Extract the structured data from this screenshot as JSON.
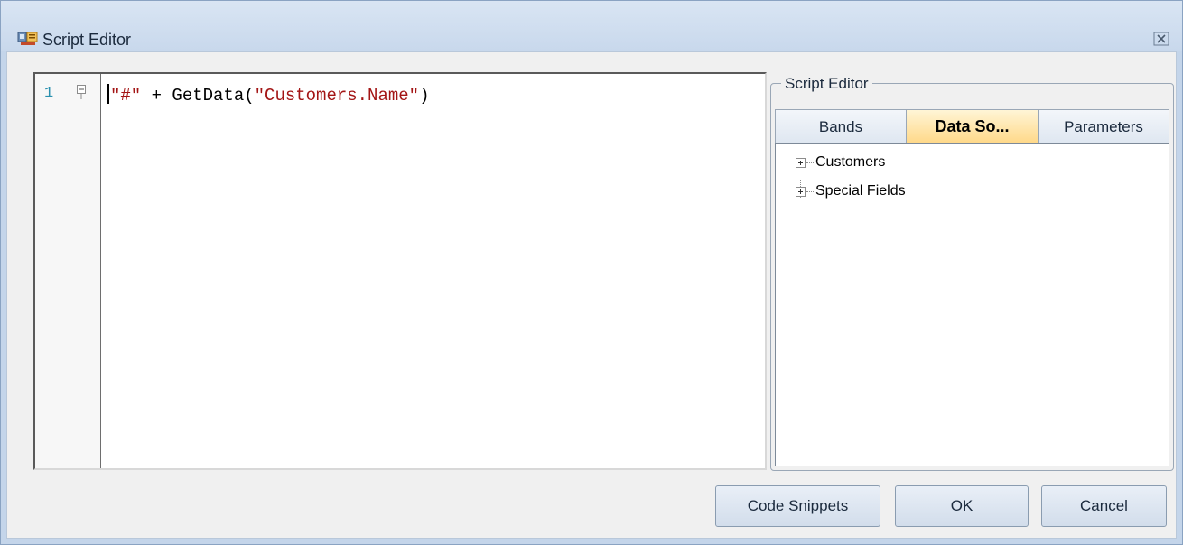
{
  "window": {
    "title": "Script Editor",
    "title_icon": "script-editor-app-icon",
    "close_icon": "close-icon"
  },
  "editor": {
    "line_number": "1",
    "fold_icon": "fold-collapse-icon",
    "code_tokens": {
      "str1": "\"#\"",
      "op": " + GetData(",
      "str2": "\"Customers.Name\"",
      "close": ")"
    },
    "string_color": "#a31515",
    "line_number_color": "#2b91af"
  },
  "side_panel": {
    "group_label": "Script Editor",
    "tabs": [
      {
        "label": "Bands",
        "active": false
      },
      {
        "label": "Data So...",
        "active": true
      },
      {
        "label": "Parameters",
        "active": false
      }
    ],
    "tree": [
      {
        "label": "Customers",
        "expander": "plus-expander-icon"
      },
      {
        "label": "Special Fields",
        "expander": "plus-expander-icon"
      }
    ]
  },
  "buttons": {
    "code_snippets": "Code Snippets",
    "ok": "OK",
    "cancel": "Cancel"
  },
  "colors": {
    "window_frame": "#c4d5ea",
    "active_tab": "#ffd98a"
  }
}
